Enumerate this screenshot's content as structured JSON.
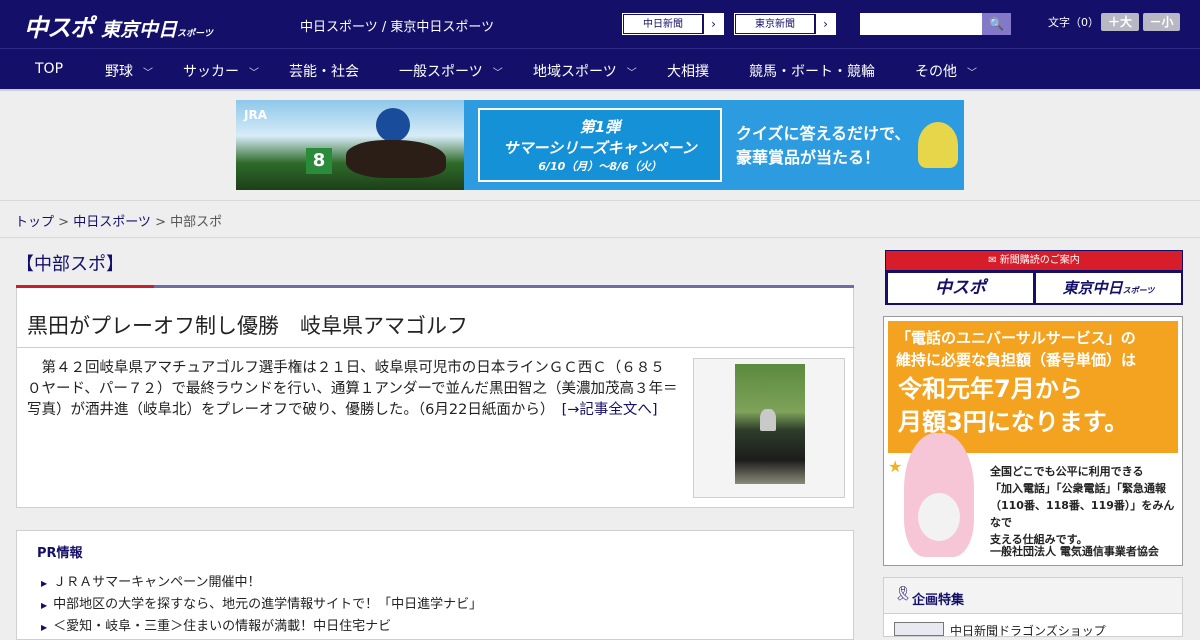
{
  "header": {
    "logo_chuspo": "中スポ",
    "logo_tokyo": "東京中日",
    "logo_tokyo_sub": "スポーツ",
    "site_name": "中日スポーツ / 東京中日スポーツ",
    "paper_buttons": [
      {
        "label": "中日新聞",
        "arrow": "›"
      },
      {
        "label": "東京新聞",
        "arrow": "›"
      }
    ],
    "search_placeholder": "",
    "search_icon": "magnifier-icon",
    "search_glyph": "🔍",
    "font_label": "文字（0）",
    "font_larger": "＋大",
    "font_smaller": "－小"
  },
  "nav": {
    "items": [
      {
        "label": "TOP",
        "chevron": ""
      },
      {
        "label": "野球",
        "chevron": "﹀"
      },
      {
        "label": "サッカー",
        "chevron": "﹀"
      },
      {
        "label": "芸能・社会",
        "chevron": ""
      },
      {
        "label": "一般スポーツ",
        "chevron": "﹀"
      },
      {
        "label": "地域スポーツ",
        "chevron": "﹀"
      },
      {
        "label": "大相撲",
        "chevron": ""
      },
      {
        "label": "競馬・ボート・競輪",
        "chevron": ""
      },
      {
        "label": "その他",
        "chevron": "﹀"
      }
    ]
  },
  "banner": {
    "jra": "JRA",
    "horse_number": "8",
    "campaign_line1": "第1弾",
    "campaign_line2": "サマーシリーズキャンペーン",
    "campaign_dates": "6/10（月）～8/6（火）",
    "tagline1": "クイズに答えるだけで、",
    "tagline2": "豪華賞品が当たる！"
  },
  "breadcrumb": {
    "top": "トップ",
    "sep1": " > ",
    "chunichi": "中日スポーツ",
    "sep2": " > ",
    "current": "中部スポ"
  },
  "section": {
    "title": "【中部スポ】"
  },
  "article": {
    "title": "黒田がプレーオフ制し優勝　岐阜県アマゴルフ",
    "body": "　第４２回岐阜県アマチュアゴルフ選手権は２１日、岐阜県可児市の日本ラインＧＣ西Ｃ（６８５０ヤード、パー７２）で最終ラウンドを行い、通算１アンダーで並んだ黒田智之（美濃加茂高３年＝写真）が酒井進（岐阜北）をプレーオフで破り、優勝した。（6月22日紙面から）",
    "more_link": "[→記事全文へ]"
  },
  "pr": {
    "title": "PR情報",
    "items": [
      "ＪＲＡサマーキャンペーン開催中！",
      "中部地区の大学を探すなら、地元の進学情報サイトで！「中日進学ナビ」",
      "＜愛知・岐阜・三重＞住まいの情報が満載！中日住宅ナビ"
    ]
  },
  "subscribe": {
    "header": "新聞購読のご案内",
    "chuspo": "中スポ",
    "tokyo": "東京中日",
    "tokyo_sub": "スポーツ"
  },
  "ad_universal": {
    "line1": "「電話のユニバーサルサービス」の",
    "line2": "維持に必要な負担額（番号単価）は",
    "line3": "令和元年7月から",
    "line4": "月額3円になります。",
    "detail1": "全国どこでも公平に利用できる",
    "detail2": "「加入電話」「公衆電話」「緊急通報",
    "detail3": "（110番、118番、119番）」をみんなで",
    "detail4": "支える仕組みです。",
    "org": "一般社団法人 電気通信事業者協会"
  },
  "special": {
    "title": "企画特集",
    "first_item": "中日新聞ドラゴンズショップ"
  }
}
